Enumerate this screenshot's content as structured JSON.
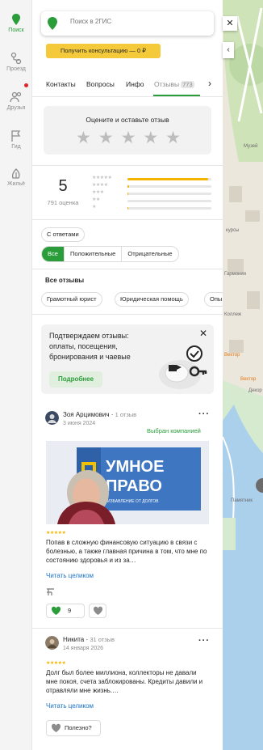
{
  "rail": {
    "items": [
      {
        "label": "Поиск",
        "icon": "pin-icon"
      },
      {
        "label": "Проезд",
        "icon": "route-icon"
      },
      {
        "label": "Друзья",
        "icon": "friends-icon"
      },
      {
        "label": "Гид",
        "icon": "flag-icon"
      },
      {
        "label": "Жильё",
        "icon": "home-icon"
      }
    ]
  },
  "search": {
    "placeholder": "Поиск в 2ГИС"
  },
  "consult_button": "Получить консультацию — 0 ₽",
  "tabs": {
    "items": [
      "Контакты",
      "Вопросы",
      "Инфо",
      "Отзывы"
    ],
    "reviews_badge": "773",
    "more_arrow": "›"
  },
  "rate_prompt": {
    "title": "Оцените и оставьте отзыв",
    "star": "★"
  },
  "summary": {
    "score": "5",
    "count": "791 оценка",
    "distribution": [
      {
        "stars": "★★★★★",
        "fraction": 0.96
      },
      {
        "stars": "★★★★",
        "fraction": 0.02
      },
      {
        "stars": "★★★",
        "fraction": 0.01
      },
      {
        "stars": "★★",
        "fraction": 0.0
      },
      {
        "stars": "★",
        "fraction": 0.01
      }
    ]
  },
  "filters": {
    "with_answers": "С ответами",
    "segments": [
      "Все",
      "Положительные",
      "Отрицательные"
    ]
  },
  "section_title": "Все отзывы",
  "tags": [
    "Грамотный юрист",
    "Юридическая помощь",
    "Опы"
  ],
  "promo": {
    "text": "Подтверждаем отзывы: оплаты, посещения, бронирования и чаевые",
    "button": "Подробнее",
    "close": "✕"
  },
  "reviews": [
    {
      "author": "Зоя Арцимович",
      "count": "1 отзыв",
      "date": "3 июня 2024",
      "chosen": "Выбран компанией",
      "stars": "★★★★★",
      "text": "Попав в сложную финансовую ситуацию в связи с болезнью, а также главная причина в том, что мне по состоянию здоровья и из за…",
      "read_more": "Читать целиком",
      "likes": "9",
      "photo_sign": [
        "УМНОЕ",
        "ПРАВО"
      ],
      "photo_sub": "ИЗБАВЛЕНИЕ ОТ ДОЛГОВ"
    },
    {
      "author": "Никита",
      "count": "31 отзыв",
      "date": "14 января 2026",
      "stars": "★★★★★",
      "text": "Долг был более миллиона, коллекторы не давали мне покоя, счета заблокированы. Кредиты давили и отравляли мне жизнь.…",
      "read_more": "Читать целиком",
      "useful": "Полезно?"
    }
  ],
  "map": {
    "close": "✕",
    "collapse": "‹",
    "labels": [
      "Музей",
      "курсы",
      "Гармония",
      "Коллеж",
      "Вектор",
      "Вектор",
      "Декор",
      "Памятник"
    ]
  },
  "colors": {
    "accent": "#2a9d3a",
    "consult": "#f4c93a",
    "star": "#f4b400",
    "link": "#1a73c8"
  }
}
